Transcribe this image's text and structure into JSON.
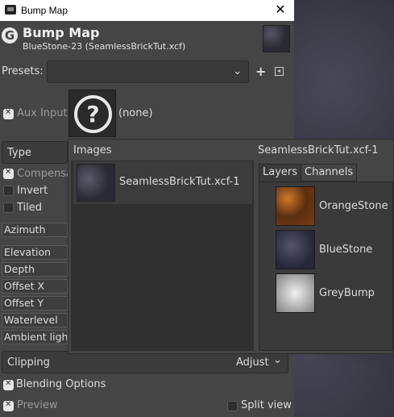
{
  "window": {
    "title": "Bump Map",
    "close_glyph": "✕"
  },
  "header": {
    "logo_glyph": "G",
    "title": "Bump Map",
    "subtitle": "BlueStone-23 (SeamlessBrickTut.xcf)"
  },
  "presets": {
    "label": "Presets:",
    "value": "",
    "arrow": "⌄",
    "add_glyph": "+"
  },
  "aux_input": {
    "label": "Aux Input",
    "checked": true,
    "icon_glyph": "?",
    "value": "(none)"
  },
  "type": {
    "label": "Type"
  },
  "options": {
    "compensate": {
      "label": "Compensa",
      "checked": true
    },
    "invert": {
      "label": "Invert",
      "checked": false
    },
    "tiled": {
      "label": "Tiled",
      "checked": false
    }
  },
  "sliders": [
    {
      "label": "Azimuth"
    },
    {
      "label": "Elevation"
    },
    {
      "label": "Depth"
    },
    {
      "label": "Offset X"
    },
    {
      "label": "Offset Y"
    },
    {
      "label": "Waterlevel"
    },
    {
      "label": "Ambient ligh"
    }
  ],
  "clipping": {
    "label": "Clipping",
    "value": "Adjust",
    "arrow": "⌄"
  },
  "blending": {
    "label": "Blending Options",
    "glyph": "+"
  },
  "preview": {
    "label": "Preview",
    "checked": true
  },
  "split_view": {
    "label": "Split view",
    "checked": false
  },
  "popup": {
    "images_header": "Images",
    "images": [
      {
        "name": "SeamlessBrickTut.xcf-1"
      }
    ],
    "image_header": "SeamlessBrickTut.xcf-1",
    "tabs": [
      {
        "label": "Layers",
        "active": true
      },
      {
        "label": "Channels",
        "active": false
      }
    ],
    "layers": [
      {
        "name": "OrangeStone"
      },
      {
        "name": "BlueStone"
      },
      {
        "name": "GreyBump"
      }
    ]
  }
}
